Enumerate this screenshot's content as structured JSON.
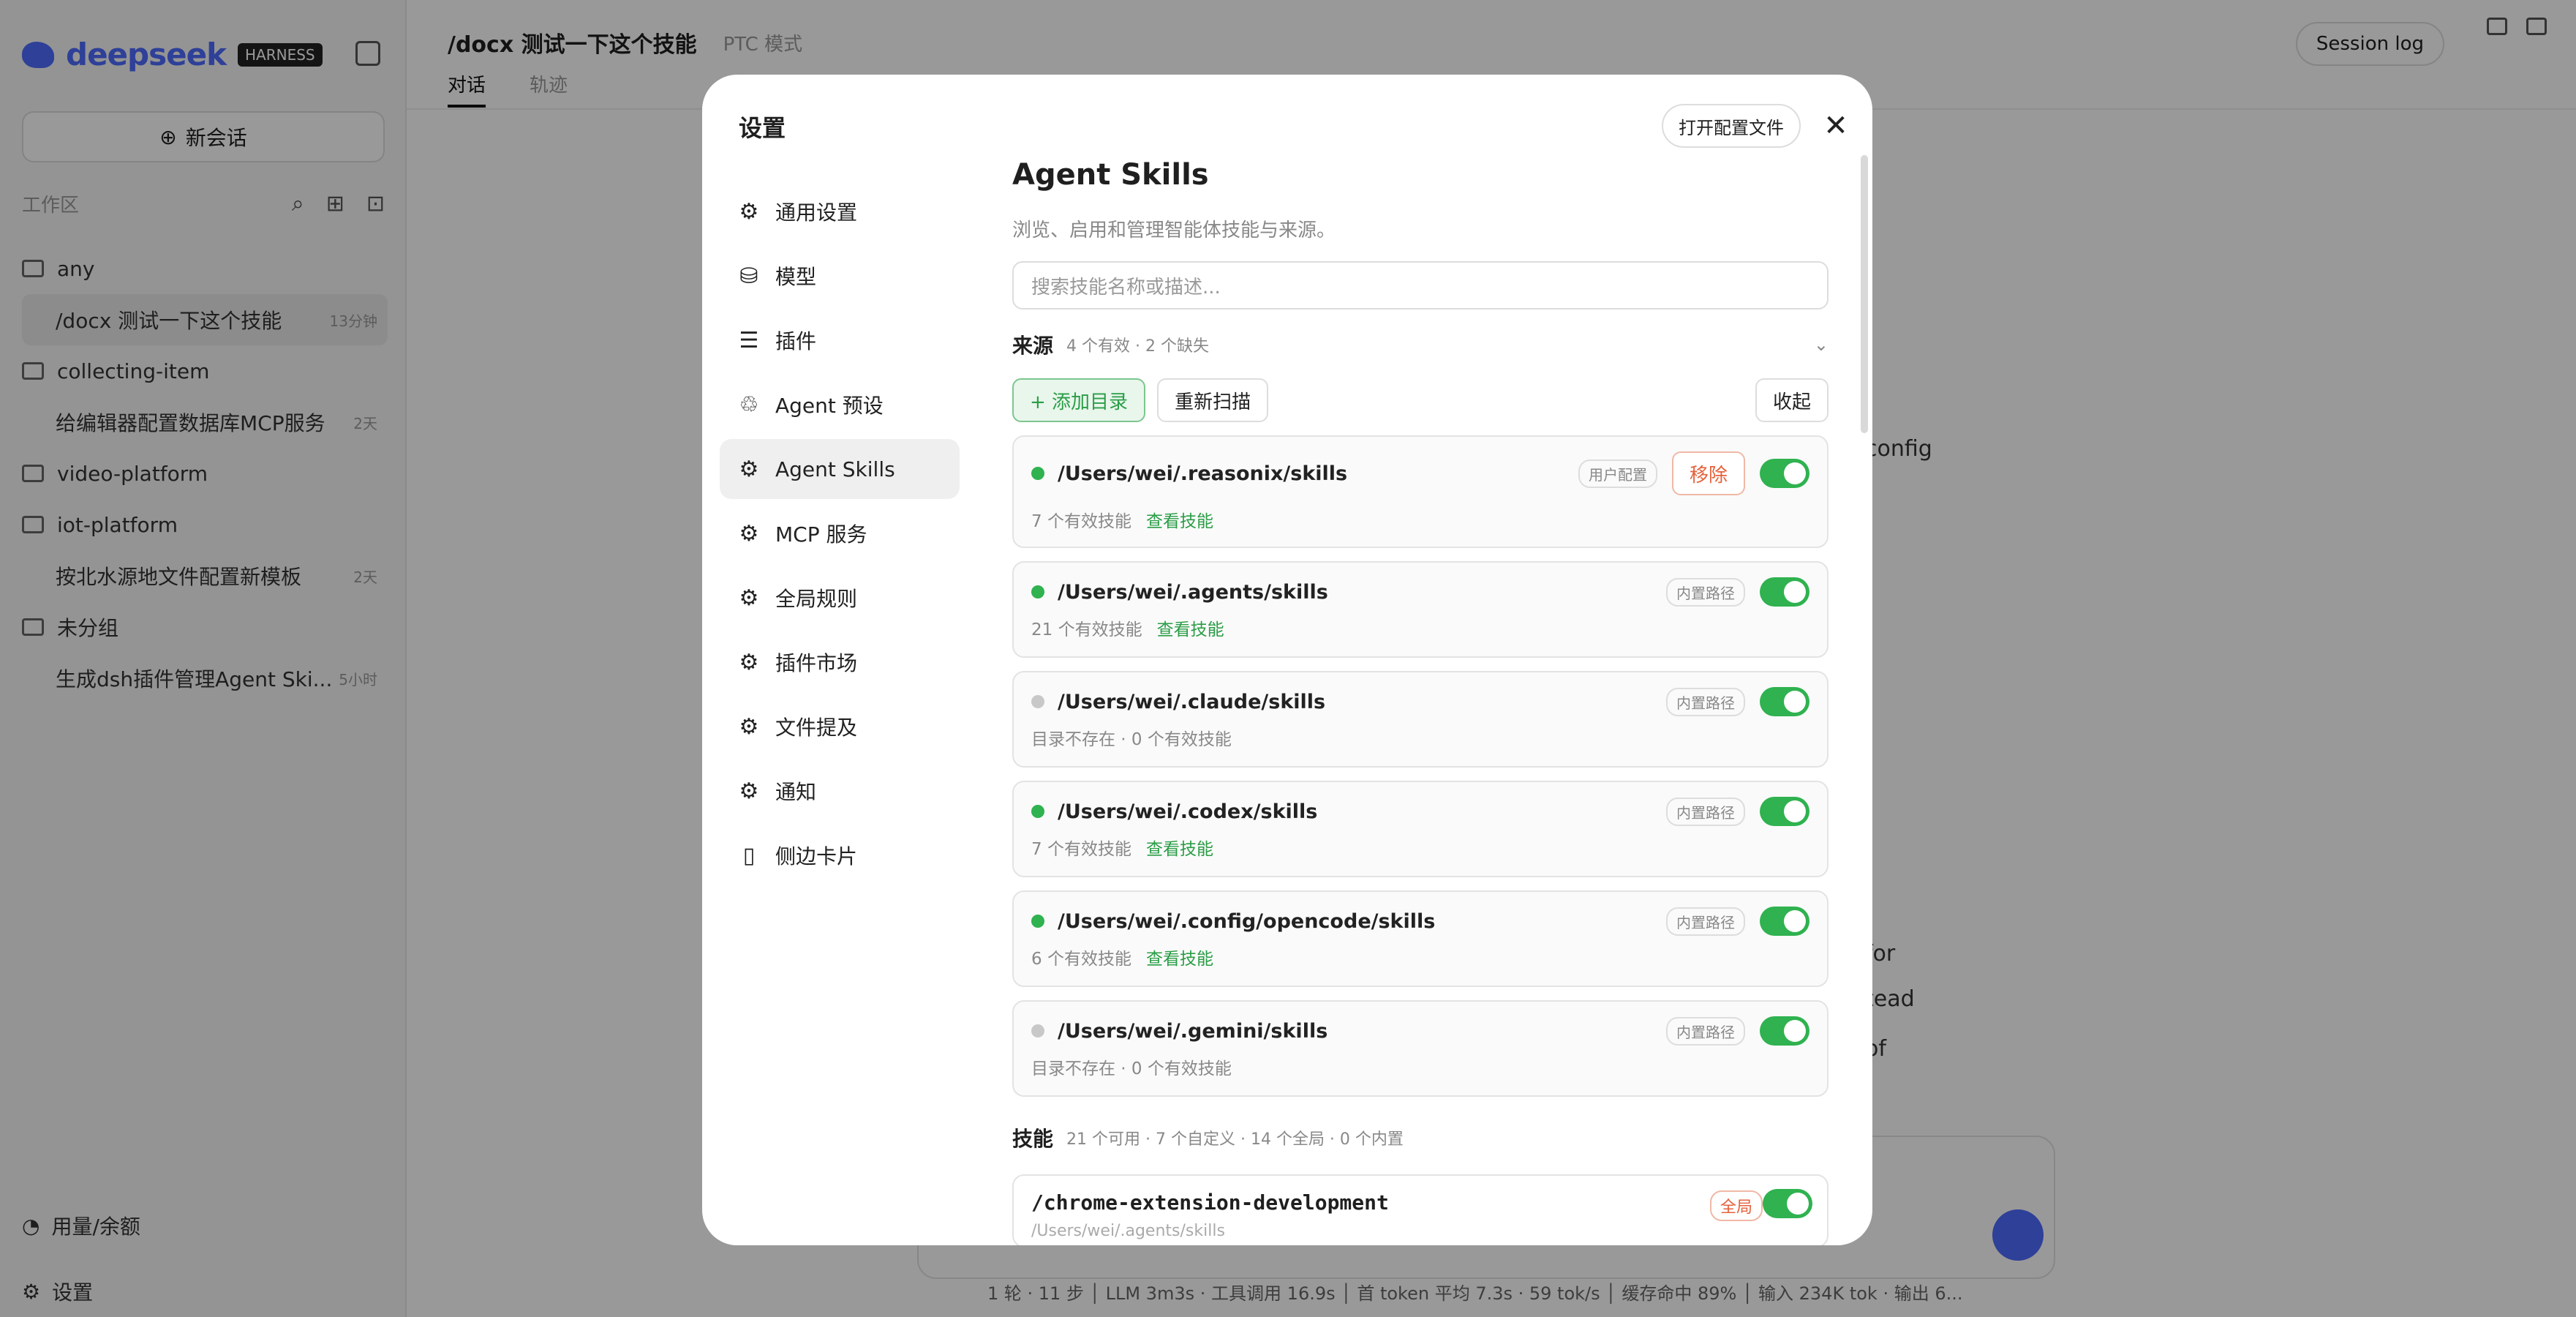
{
  "sidebar": {
    "brand": "deepseek",
    "badge": "HARNESS",
    "new_chat": "新会话",
    "workspace_label": "工作区",
    "tree": [
      {
        "type": "folder",
        "label": "any"
      },
      {
        "type": "chat",
        "label": "/docx 测试一下这个技能",
        "time": "13分钟",
        "active": true
      },
      {
        "type": "folder",
        "label": "collecting-item"
      },
      {
        "type": "chat",
        "label": "给编辑器配置数据库MCP服务",
        "time": "2天"
      },
      {
        "type": "folder",
        "label": "video-platform"
      },
      {
        "type": "folder",
        "label": "iot-platform"
      },
      {
        "type": "chat",
        "label": "按北水源地文件配置新模板",
        "time": "2天"
      },
      {
        "type": "folder",
        "label": "未分组"
      },
      {
        "type": "chat",
        "label": "生成dsh插件管理Agent Ski...",
        "time": "5小时"
      }
    ],
    "bottom": [
      "用量/余额",
      "设置"
    ]
  },
  "main": {
    "title": "/docx 测试一下这个技能",
    "mode": "PTC 模式",
    "tabs": [
      "对话",
      "轨迹"
    ],
    "session_log": "Session log",
    "chat_fragments": [
      "config",
      "for",
      "tead of"
    ],
    "status_bar": "1 轮 · 11 步 │ LLM 3m3s · 工具调用 16.9s │ 首 token 平均 7.3s · 59 tok/s │ 缓存命中 89% │ 输入 234K tok · 输出 6..."
  },
  "settings": {
    "title": "设置",
    "open_config": "打开配置文件",
    "nav": [
      {
        "label": "通用设置",
        "icon": "gear-icon"
      },
      {
        "label": "模型",
        "icon": "database-icon"
      },
      {
        "label": "插件",
        "icon": "sliders-icon"
      },
      {
        "label": "Agent 预设",
        "icon": "recycle-icon"
      },
      {
        "label": "Agent Skills",
        "icon": "gear-icon",
        "active": true
      },
      {
        "label": "MCP 服务",
        "icon": "gear-icon"
      },
      {
        "label": "全局规则",
        "icon": "gear-icon"
      },
      {
        "label": "插件市场",
        "icon": "gear-icon"
      },
      {
        "label": "文件提及",
        "icon": "gear-icon"
      },
      {
        "label": "通知",
        "icon": "gear-icon"
      },
      {
        "label": "侧边卡片",
        "icon": "cards-icon"
      }
    ],
    "content": {
      "heading": "Agent Skills",
      "subtitle": "浏览、启用和管理智能体技能与来源。",
      "search_placeholder": "搜索技能名称或描述...",
      "sources_label": "来源",
      "sources_count": "4 个有效 · 2 个缺失",
      "add_dir": "+ 添加目录",
      "rescan": "重新扫描",
      "collapse": "收起",
      "sources": [
        {
          "path": "/Users/wei/.reasonix/skills",
          "status": "7 个有效技能",
          "link": "查看技能",
          "tag": "用户配置",
          "remove": "移除",
          "ok": true
        },
        {
          "path": "/Users/wei/.agents/skills",
          "status": "21 个有效技能",
          "link": "查看技能",
          "tag": "内置路径",
          "ok": true
        },
        {
          "path": "/Users/wei/.claude/skills",
          "status": "目录不存在 · 0 个有效技能",
          "link": "",
          "tag": "内置路径",
          "ok": false
        },
        {
          "path": "/Users/wei/.codex/skills",
          "status": "7 个有效技能",
          "link": "查看技能",
          "tag": "内置路径",
          "ok": true
        },
        {
          "path": "/Users/wei/.config/opencode/skills",
          "status": "6 个有效技能",
          "link": "查看技能",
          "tag": "内置路径",
          "ok": true
        },
        {
          "path": "/Users/wei/.gemini/skills",
          "status": "目录不存在 · 0 个有效技能",
          "link": "",
          "tag": "内置路径",
          "ok": false
        }
      ],
      "skills_label": "技能",
      "skills_count": "21 个可用 · 7 个自定义 · 14 个全局 · 0 个内置",
      "skill": {
        "name": "/chrome-extension-development",
        "tag": "全局",
        "path": "/Users/wei/.agents/skills"
      }
    }
  },
  "colors": {
    "accent": "#2fb24f",
    "brand": "#4d6bfe",
    "danger": "#e5623d"
  }
}
